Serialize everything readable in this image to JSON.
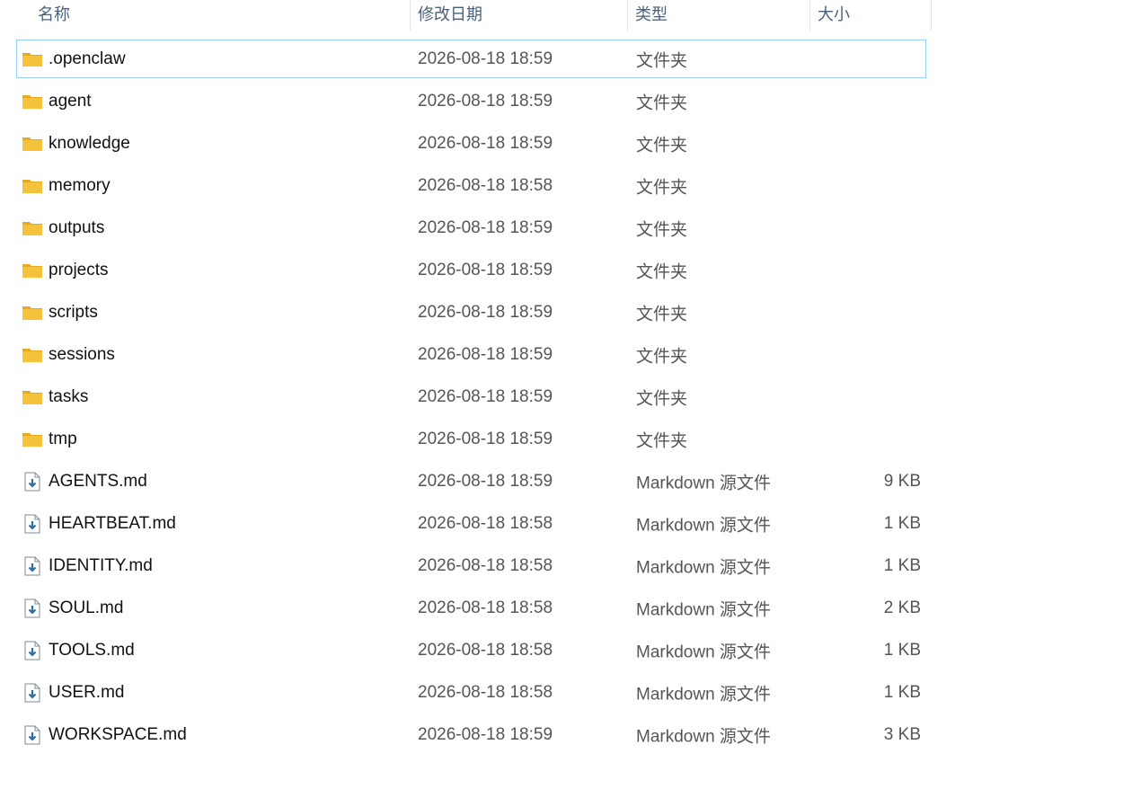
{
  "columns": {
    "name": "名称",
    "date": "修改日期",
    "type": "类型",
    "size": "大小"
  },
  "icons": {
    "folder": "folder-icon",
    "markdown": "markdown-file-icon",
    "folder_color": "#f5c33b",
    "folder_tab_color": "#e8a91d",
    "file_accent": "#2f6f9f"
  },
  "files": [
    {
      "name": ".openclaw",
      "date": "2026-08-18 18:59",
      "type": "文件夹",
      "size": "",
      "kind": "folder"
    },
    {
      "name": "agent",
      "date": "2026-08-18 18:59",
      "type": "文件夹",
      "size": "",
      "kind": "folder"
    },
    {
      "name": "knowledge",
      "date": "2026-08-18 18:59",
      "type": "文件夹",
      "size": "",
      "kind": "folder"
    },
    {
      "name": "memory",
      "date": "2026-08-18 18:58",
      "type": "文件夹",
      "size": "",
      "kind": "folder"
    },
    {
      "name": "outputs",
      "date": "2026-08-18 18:59",
      "type": "文件夹",
      "size": "",
      "kind": "folder"
    },
    {
      "name": "projects",
      "date": "2026-08-18 18:59",
      "type": "文件夹",
      "size": "",
      "kind": "folder"
    },
    {
      "name": "scripts",
      "date": "2026-08-18 18:59",
      "type": "文件夹",
      "size": "",
      "kind": "folder"
    },
    {
      "name": "sessions",
      "date": "2026-08-18 18:59",
      "type": "文件夹",
      "size": "",
      "kind": "folder"
    },
    {
      "name": "tasks",
      "date": "2026-08-18 18:59",
      "type": "文件夹",
      "size": "",
      "kind": "folder"
    },
    {
      "name": "tmp",
      "date": "2026-08-18 18:59",
      "type": "文件夹",
      "size": "",
      "kind": "folder"
    },
    {
      "name": "AGENTS.md",
      "date": "2026-08-18 18:59",
      "type": "Markdown 源文件",
      "size": "9 KB",
      "kind": "markdown"
    },
    {
      "name": "HEARTBEAT.md",
      "date": "2026-08-18 18:58",
      "type": "Markdown 源文件",
      "size": "1 KB",
      "kind": "markdown"
    },
    {
      "name": "IDENTITY.md",
      "date": "2026-08-18 18:58",
      "type": "Markdown 源文件",
      "size": "1 KB",
      "kind": "markdown"
    },
    {
      "name": "SOUL.md",
      "date": "2026-08-18 18:58",
      "type": "Markdown 源文件",
      "size": "2 KB",
      "kind": "markdown"
    },
    {
      "name": "TOOLS.md",
      "date": "2026-08-18 18:58",
      "type": "Markdown 源文件",
      "size": "1 KB",
      "kind": "markdown"
    },
    {
      "name": "USER.md",
      "date": "2026-08-18 18:58",
      "type": "Markdown 源文件",
      "size": "1 KB",
      "kind": "markdown"
    },
    {
      "name": "WORKSPACE.md",
      "date": "2026-08-18 18:59",
      "type": "Markdown 源文件",
      "size": "3 KB",
      "kind": "markdown"
    }
  ]
}
